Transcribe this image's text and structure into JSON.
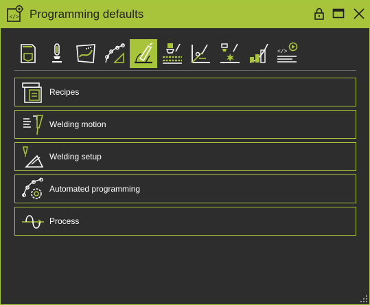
{
  "window": {
    "title": "Programming defaults",
    "accent_color": "#a8c43a",
    "background_color": "#2d2d2d"
  },
  "titlebar_controls": [
    {
      "name": "lock-icon"
    },
    {
      "name": "maximize-icon"
    },
    {
      "name": "close-icon"
    }
  ],
  "toolbar": {
    "tools": [
      {
        "name": "welding-program-icon",
        "active": false
      },
      {
        "name": "torch-icon",
        "active": false
      },
      {
        "name": "workpiece-map-icon",
        "active": false
      },
      {
        "name": "path-points-icon",
        "active": false
      },
      {
        "name": "welding-angle-icon",
        "active": true
      },
      {
        "name": "weave-pattern-icon",
        "active": false
      },
      {
        "name": "joint-setup-icon",
        "active": false
      },
      {
        "name": "tack-weld-icon",
        "active": false
      },
      {
        "name": "ramp-curve-icon",
        "active": false
      },
      {
        "name": "code-play-icon",
        "active": false
      }
    ]
  },
  "menu": {
    "items": [
      {
        "label": "Recipes",
        "icon": "recipes-icon"
      },
      {
        "label": "Welding motion",
        "icon": "welding-motion-icon"
      },
      {
        "label": "Welding setup",
        "icon": "welding-setup-icon"
      },
      {
        "label": "Automated programming",
        "icon": "automated-programming-icon"
      },
      {
        "label": "Process",
        "icon": "process-icon"
      }
    ]
  }
}
